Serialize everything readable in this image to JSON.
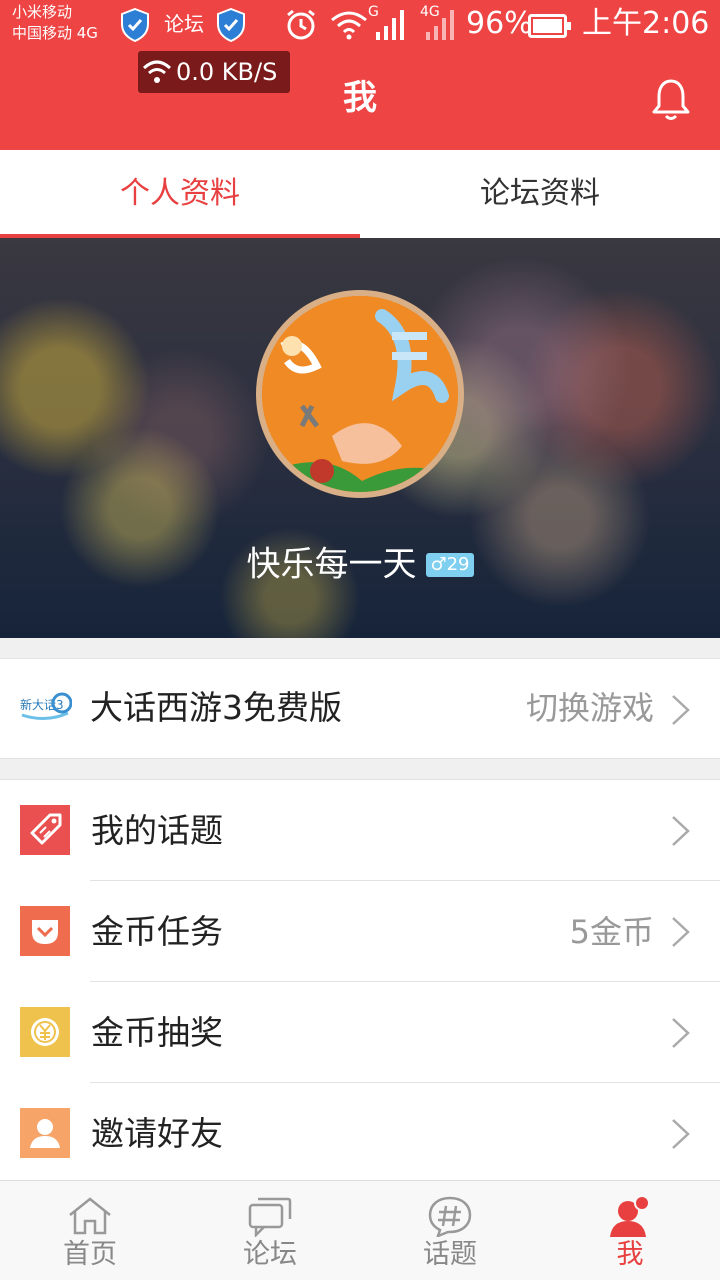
{
  "status_bar": {
    "carrier_line1": "小米移动",
    "carrier_line2": "中国移动 4G",
    "forum_icon_text": "论坛",
    "battery": "96%",
    "time": "上午2:06",
    "net_speed": "0.0 KB/S",
    "g_label": "G",
    "fourg_label": "4G"
  },
  "header": {
    "title": "我"
  },
  "tabs": [
    {
      "label": "个人资料",
      "active": true
    },
    {
      "label": "论坛资料",
      "active": false
    }
  ],
  "profile": {
    "username": "快乐每一天",
    "gender_symbol": "♂",
    "level": "29"
  },
  "game": {
    "name": "大话西游3免费版",
    "switch_label": "切换游戏",
    "logo_text": "新大话3"
  },
  "menu": [
    {
      "label": "我的话题",
      "value": "",
      "icon": "tag-icon",
      "color": "#e9504f"
    },
    {
      "label": "金币任务",
      "value": "5金币",
      "icon": "pocket-icon",
      "color": "#ef6c4e"
    },
    {
      "label": "金币抽奖",
      "value": "",
      "icon": "yen-coin-icon",
      "color": "#efc24d"
    },
    {
      "label": "邀请好友",
      "value": "",
      "icon": "person-icon",
      "color": "#f6a468"
    }
  ],
  "bottom_nav": [
    {
      "label": "首页",
      "icon": "home-icon",
      "active": false
    },
    {
      "label": "论坛",
      "icon": "chat-bubbles-icon",
      "active": false
    },
    {
      "label": "话题",
      "icon": "hashtag-icon",
      "active": false
    },
    {
      "label": "我",
      "icon": "user-icon",
      "active": true
    }
  ],
  "colors": {
    "brand_red": "#ee4444",
    "accent": "#e84040",
    "muted_text": "#999999"
  }
}
